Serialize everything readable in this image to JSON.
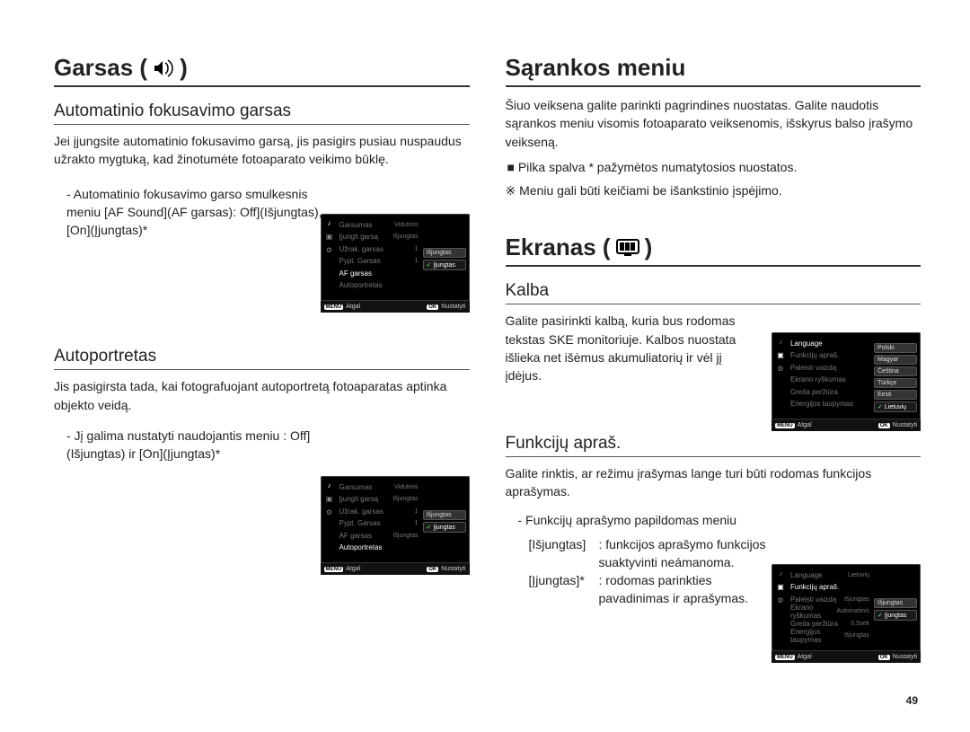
{
  "page": "49",
  "left": {
    "title": "Garsas (",
    "title_close": ")",
    "sub1": {
      "heading": "Automatinio fokusavimo garsas",
      "para": "Jei įjungsite automatinio fokusavimo garsą, jis pasigirs pusiau nuspaudus užrakto mygtuką, kad žinotumėte fotoaparato veikimo būklę.",
      "bullet1": "- Automatinio fokusavimo garso smulkesnis meniu [AF Sound](AF garsas): Off](Išjungtas), [On](Įjungtas)*"
    },
    "sub2": {
      "heading": "Autoportretas",
      "para": "Jis pasigirsta tada, kai fotografuojant autoportretą fotoaparatas aptinka objekto veidą.",
      "bullet1": "- Jį galima nustatyti naudojantis meniu : Off](Išjungtas) ir [On](Įjungtas)*"
    }
  },
  "right": {
    "title1": "Sąrankos meniu",
    "para1": "Šiuo veiksena galite parinkti pagrindines nuostatas. Galite naudotis sąrankos meniu visomis fotoaparato veiksenomis, išskyrus balso įrašymo veikseną.",
    "bullet_sq": "■ Pilka spalva * pažymėtos numatytosios nuostatos.",
    "note": "※ Meniu gali būti keičiami be išankstinio įspėjimo.",
    "title2": "Ekranas (",
    "title2_close": ")",
    "sub1": {
      "heading": "Kalba",
      "para": "Galite pasirinkti kalbą, kuria bus rodomas tekstas SKE monitoriuje. Kalbos nuostata išlieka net išėmus akumuliatorių ir vėl jį įdėjus."
    },
    "sub2": {
      "heading": "Funkcijų apraš.",
      "para": "Galite rinktis, ar režimu įrašymas lange turi būti rodomas funkcijos aprašymas.",
      "bullet1": "- Funkcijų aprašymo papildomas meniu",
      "opt_off_l": "[Išjungtas]",
      "opt_off_r": ": funkcijos aprašymo funkcijos suaktyvinti neámanoma.",
      "opt_on_l": "[Įjungtas]*",
      "opt_on_r": ": rodomas parinkties pavadinimas ir aprašymas."
    }
  },
  "lcd_common": {
    "back_btn": "MENU",
    "back": "Atgal",
    "ok_btn": "OK",
    "set": "Nustatyti"
  },
  "lcd1": {
    "rows": [
      {
        "l": "Garsumas",
        "r": "Vidutinis"
      },
      {
        "l": "Įjungti garsą",
        "r": "Išjungtas"
      },
      {
        "l": "Užrak. garsas",
        "r": "1"
      },
      {
        "l": "Pypt. Garsas",
        "r": "1"
      },
      {
        "l": "AF garsas",
        "r": ""
      },
      {
        "l": "Autoportretas",
        "r": ""
      }
    ],
    "active_index": 4,
    "opts": [
      "Išjungtas",
      "Įjungtas"
    ],
    "opt_sel": 1
  },
  "lcd2": {
    "rows": [
      {
        "l": "Garsumas",
        "r": "Vidutinis"
      },
      {
        "l": "Įjungti garsą",
        "r": "Išjungtas"
      },
      {
        "l": "Užrak. garsas",
        "r": "1"
      },
      {
        "l": "Pypt. Garsas",
        "r": "1"
      },
      {
        "l": "AF garsas",
        "r": "Išjungtas"
      },
      {
        "l": "Autoportretas",
        "r": ""
      }
    ],
    "active_index": 5,
    "opts": [
      "Išjungtas",
      "Įjungtas"
    ],
    "opt_sel": 1
  },
  "lcd3": {
    "rows": [
      {
        "l": "Language",
        "r": ""
      },
      {
        "l": "Funkcijų apraš.",
        "r": ""
      },
      {
        "l": "Paleisti vaizdą",
        "r": ""
      },
      {
        "l": "Ekrano ryškumas",
        "r": ""
      },
      {
        "l": "Greita peržiūra",
        "r": ""
      },
      {
        "l": "Energijos taupymas",
        "r": ""
      }
    ],
    "active_index": 0,
    "opts": [
      "Polski",
      "Magyar",
      "Čeština",
      "Türkçe",
      "Eesti",
      "Lietuvių"
    ],
    "opt_sel": 5
  },
  "lcd4": {
    "rows": [
      {
        "l": "Language",
        "r": "Lietuvių"
      },
      {
        "l": "Funkcijų apraš.",
        "r": ""
      },
      {
        "l": "Paleisti vaizdą",
        "r": "Išjungtas"
      },
      {
        "l": "Ekrano ryškumas",
        "r": "Automatinis"
      },
      {
        "l": "Greita peržiūra",
        "r": "0.5sek"
      },
      {
        "l": "Energijos taupymas",
        "r": "Išjungtas"
      }
    ],
    "active_index": 1,
    "opts": [
      "Išjungtas",
      "Įjungtas"
    ],
    "opt_sel": 1
  }
}
